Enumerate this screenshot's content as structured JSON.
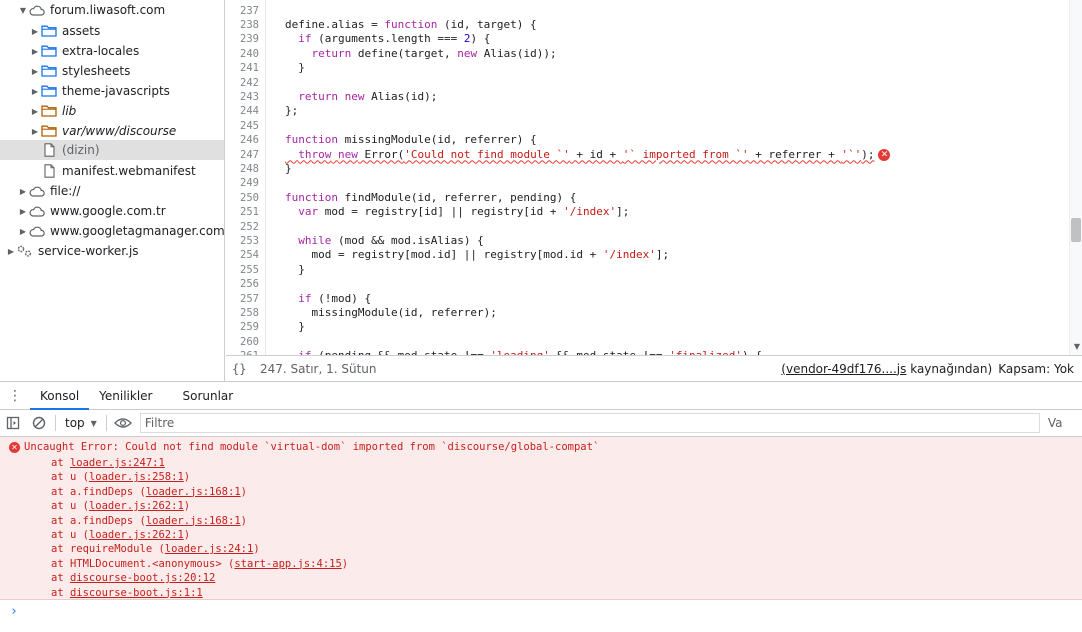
{
  "navigator": {
    "items": [
      {
        "label": "forum.liwasoft.com",
        "icon": "cloud-icon",
        "expanded": true,
        "depth": 1
      },
      {
        "label": "assets",
        "icon": "folder-icon",
        "depth": 2
      },
      {
        "label": "extra-locales",
        "icon": "folder-icon",
        "depth": 2
      },
      {
        "label": "stylesheets",
        "icon": "folder-icon",
        "depth": 2
      },
      {
        "label": "theme-javascripts",
        "icon": "folder-icon",
        "depth": 2
      },
      {
        "label": "lib",
        "icon": "folder-icon",
        "depth": 2,
        "italic": true
      },
      {
        "label": "var/www/discourse",
        "icon": "folder-icon",
        "depth": 2,
        "italic": true
      },
      {
        "label": "(dizin)",
        "icon": "file-icon",
        "depth": 2,
        "selected": true
      },
      {
        "label": "manifest.webmanifest",
        "icon": "file-icon",
        "depth": 2
      },
      {
        "label": "file://",
        "icon": "cloud-icon",
        "depth": 1
      },
      {
        "label": "www.google.com.tr",
        "icon": "cloud-icon",
        "depth": 1
      },
      {
        "label": "www.googletagmanager.com",
        "icon": "cloud-icon",
        "depth": 1
      },
      {
        "label": "service-worker.js",
        "icon": "gear-icon",
        "depth": 0
      }
    ]
  },
  "editor": {
    "line_numbers": [
      "237",
      "238",
      "239",
      "240",
      "241",
      "242",
      "243",
      "244",
      "245",
      "246",
      "247",
      "248",
      "249",
      "250",
      "251",
      "252",
      "253",
      "254",
      "255",
      "256",
      "257",
      "258",
      "259",
      "260",
      "261"
    ],
    "lines": {
      "l238": [
        "",
        "define.alias = ",
        "function",
        " (id, target) {"
      ],
      "l239": [
        "  ",
        "if",
        " (arguments.length === ",
        "2",
        ") {"
      ],
      "l240": [
        "    ",
        "return",
        " define(target, ",
        "new",
        " Alias(id));"
      ],
      "l241": [
        "  }"
      ],
      "l243": [
        "  ",
        "return",
        " ",
        "new",
        " Alias(id);"
      ],
      "l244": [
        "};"
      ],
      "l246": [
        "",
        "function",
        " missingModule(id, referrer) {"
      ],
      "l247": [
        "  ",
        "throw",
        " ",
        "new",
        " Error(",
        "'Could not find module `'",
        " + id + ",
        "'` imported from `'",
        " + referrer + ",
        "'`'",
        ");"
      ],
      "l248": [
        "}"
      ],
      "l250": [
        "",
        "function",
        " findModule(id, referrer, pending) {"
      ],
      "l251": [
        "  ",
        "var",
        " mod = registry[id] || registry[id + ",
        "'/index'",
        "];"
      ],
      "l253": [
        "  ",
        "while",
        " (mod && mod.isAlias) {"
      ],
      "l254": [
        "    mod = registry[mod.id] || registry[mod.id + ",
        "'/index'",
        "];"
      ],
      "l255": [
        "  }"
      ],
      "l257": [
        "  ",
        "if",
        " (!mod) {"
      ],
      "l258": [
        "    missingModule(id, referrer);"
      ],
      "l259": [
        "  }"
      ],
      "l261": [
        "  ",
        "if",
        " (pending && mod.state !== ",
        "'loading'",
        " && mod.state !== ",
        "'finalized'",
        ") {"
      ]
    },
    "error_badge": "✕"
  },
  "statusbar": {
    "format_icon": "{}",
    "cursor_position": "247. Satır, 1. Sütun",
    "source_file": "(vendor-49df176....js",
    "source_suffix": "kaynağından)",
    "coverage": "Kapsam: Yok"
  },
  "drawer": {
    "tabs": [
      "Konsol",
      "Yenilikler",
      "Sorunlar"
    ],
    "active_tab": "Konsol"
  },
  "console_toolbar": {
    "context": "top",
    "filter_placeholder": "Filtre",
    "levels_truncated": "Va"
  },
  "console": {
    "error_message": "Uncaught Error: Could not find module `virtual-dom` imported from `discourse/global-compat`",
    "stack": [
      {
        "prefix": "at ",
        "loc": "loader.js:247:1",
        "paren": false
      },
      {
        "prefix": "at u (",
        "loc": "loader.js:258:1",
        "paren": true
      },
      {
        "prefix": "at a.findDeps (",
        "loc": "loader.js:168:1",
        "paren": true
      },
      {
        "prefix": "at u (",
        "loc": "loader.js:262:1",
        "paren": true
      },
      {
        "prefix": "at a.findDeps (",
        "loc": "loader.js:168:1",
        "paren": true
      },
      {
        "prefix": "at u (",
        "loc": "loader.js:262:1",
        "paren": true
      },
      {
        "prefix": "at requireModule (",
        "loc": "loader.js:24:1",
        "paren": true
      },
      {
        "prefix": "at HTMLDocument.<anonymous> (",
        "loc": "start-app.js:4:15",
        "paren": true
      },
      {
        "prefix": "at ",
        "loc": "discourse-boot.js:20:12",
        "paren": false
      },
      {
        "prefix": "at ",
        "loc": "discourse-boot.js:1:1",
        "paren": false
      }
    ],
    "prompt": "›"
  },
  "colors": {
    "keyword": "#a626a4",
    "string": "#c41a16",
    "number": "#1c00cf",
    "error": "#c5221f",
    "error_bg": "#fcebeb",
    "accent": "#1a73e8",
    "folder_blue": "#1a73e8",
    "folder_orange": "#b06000"
  }
}
